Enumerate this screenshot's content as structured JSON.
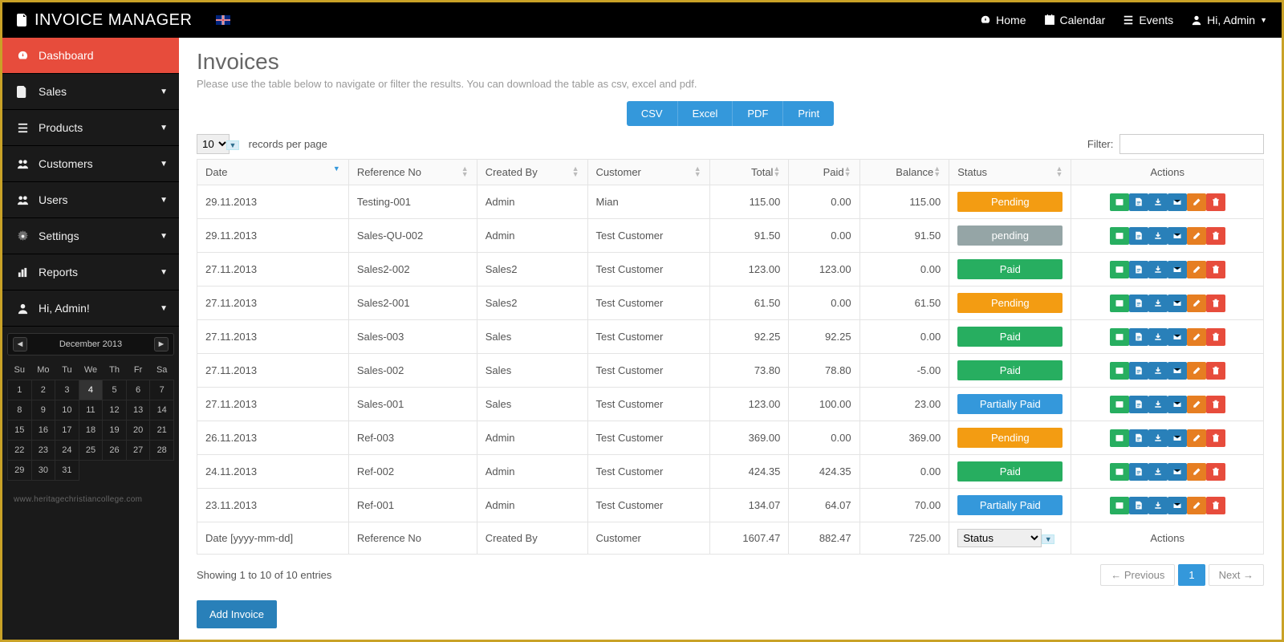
{
  "brand": "INVOICE MANAGER",
  "topnav": {
    "home": "Home",
    "calendar": "Calendar",
    "events": "Events",
    "user": "Hi, Admin"
  },
  "sidebar": {
    "items": [
      {
        "label": "Dashboard",
        "active": true
      },
      {
        "label": "Sales"
      },
      {
        "label": "Products"
      },
      {
        "label": "Customers"
      },
      {
        "label": "Users"
      },
      {
        "label": "Settings"
      },
      {
        "label": "Reports"
      },
      {
        "label": "Hi, Admin!"
      }
    ]
  },
  "calendar": {
    "title": "December 2013",
    "dow": [
      "Su",
      "Mo",
      "Tu",
      "We",
      "Th",
      "Fr",
      "Sa"
    ],
    "days": [
      [
        1,
        2,
        3,
        4,
        5,
        6,
        7
      ],
      [
        8,
        9,
        10,
        11,
        12,
        13,
        14
      ],
      [
        15,
        16,
        17,
        18,
        19,
        20,
        21
      ],
      [
        22,
        23,
        24,
        25,
        26,
        27,
        28
      ],
      [
        29,
        30,
        31,
        null,
        null,
        null,
        null
      ]
    ],
    "selected": 4
  },
  "footer_text": "www.heritagechristiancollege.com",
  "page": {
    "title": "Invoices",
    "subtitle": "Please use the table below to navigate or filter the results. You can download the table as csv, excel and pdf.",
    "export": [
      "CSV",
      "Excel",
      "PDF",
      "Print"
    ],
    "page_len": "10",
    "page_len_label": "records per page",
    "filter_label": "Filter:",
    "columns": [
      "Date",
      "Reference No",
      "Created By",
      "Customer",
      "Total",
      "Paid",
      "Balance",
      "Status",
      "Actions"
    ],
    "rows": [
      {
        "date": "29.11.2013",
        "ref": "Testing-001",
        "by": "Admin",
        "cust": "Mian",
        "total": "115.00",
        "paid": "0.00",
        "bal": "115.00",
        "status": "Pending",
        "sclass": "s-orange"
      },
      {
        "date": "29.11.2013",
        "ref": "Sales-QU-002",
        "by": "Admin",
        "cust": "Test Customer",
        "total": "91.50",
        "paid": "0.00",
        "bal": "91.50",
        "status": "pending",
        "sclass": "s-grey"
      },
      {
        "date": "27.11.2013",
        "ref": "Sales2-002",
        "by": "Sales2",
        "cust": "Test Customer",
        "total": "123.00",
        "paid": "123.00",
        "bal": "0.00",
        "status": "Paid",
        "sclass": "s-green"
      },
      {
        "date": "27.11.2013",
        "ref": "Sales2-001",
        "by": "Sales2",
        "cust": "Test Customer",
        "total": "61.50",
        "paid": "0.00",
        "bal": "61.50",
        "status": "Pending",
        "sclass": "s-orange"
      },
      {
        "date": "27.11.2013",
        "ref": "Sales-003",
        "by": "Sales",
        "cust": "Test Customer",
        "total": "92.25",
        "paid": "92.25",
        "bal": "0.00",
        "status": "Paid",
        "sclass": "s-green"
      },
      {
        "date": "27.11.2013",
        "ref": "Sales-002",
        "by": "Sales",
        "cust": "Test Customer",
        "total": "73.80",
        "paid": "78.80",
        "bal": "-5.00",
        "status": "Paid",
        "sclass": "s-green"
      },
      {
        "date": "27.11.2013",
        "ref": "Sales-001",
        "by": "Sales",
        "cust": "Test Customer",
        "total": "123.00",
        "paid": "100.00",
        "bal": "23.00",
        "status": "Partially Paid",
        "sclass": "s-blue"
      },
      {
        "date": "26.11.2013",
        "ref": "Ref-003",
        "by": "Admin",
        "cust": "Test Customer",
        "total": "369.00",
        "paid": "0.00",
        "bal": "369.00",
        "status": "Pending",
        "sclass": "s-orange"
      },
      {
        "date": "24.11.2013",
        "ref": "Ref-002",
        "by": "Admin",
        "cust": "Test Customer",
        "total": "424.35",
        "paid": "424.35",
        "bal": "0.00",
        "status": "Paid",
        "sclass": "s-green"
      },
      {
        "date": "23.11.2013",
        "ref": "Ref-001",
        "by": "Admin",
        "cust": "Test Customer",
        "total": "134.07",
        "paid": "64.07",
        "bal": "70.00",
        "status": "Partially Paid",
        "sclass": "s-blue"
      }
    ],
    "footer": {
      "date": "Date [yyyy-mm-dd]",
      "ref": "Reference No",
      "by": "Created By",
      "cust": "Customer",
      "total": "1607.47",
      "paid": "882.47",
      "bal": "725.00",
      "status": "Status",
      "actions": "Actions"
    },
    "info": "Showing 1 to 10 of 10 entries",
    "prev": "← Previous",
    "page1": "1",
    "next": "Next →",
    "add": "Add Invoice"
  }
}
